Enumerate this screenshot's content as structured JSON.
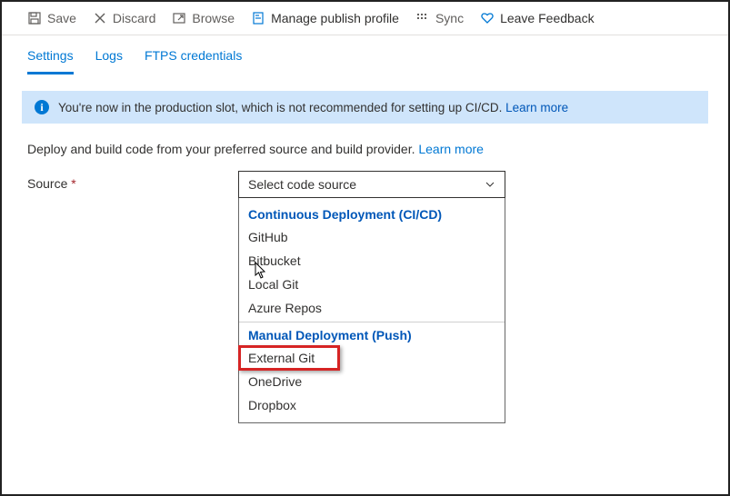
{
  "toolbar": {
    "save": "Save",
    "discard": "Discard",
    "browse": "Browse",
    "manage_profile": "Manage publish profile",
    "sync": "Sync",
    "feedback": "Leave Feedback"
  },
  "tabs": {
    "settings": "Settings",
    "logs": "Logs",
    "ftps": "FTPS credentials"
  },
  "info": {
    "text": "You're now in the production slot, which is not recommended for setting up CI/CD.",
    "learn_more": "Learn more"
  },
  "description": {
    "text": "Deploy and build code from your preferred source and build provider.",
    "learn_more": "Learn more"
  },
  "form": {
    "source_label": "Source",
    "source_placeholder": "Select code source"
  },
  "dropdown": {
    "group1": {
      "header": "Continuous Deployment (CI/CD)",
      "options": [
        "GitHub",
        "Bitbucket",
        "Local Git",
        "Azure Repos"
      ]
    },
    "group2": {
      "header": "Manual Deployment (Push)",
      "options": [
        "External Git",
        "OneDrive",
        "Dropbox"
      ]
    }
  }
}
